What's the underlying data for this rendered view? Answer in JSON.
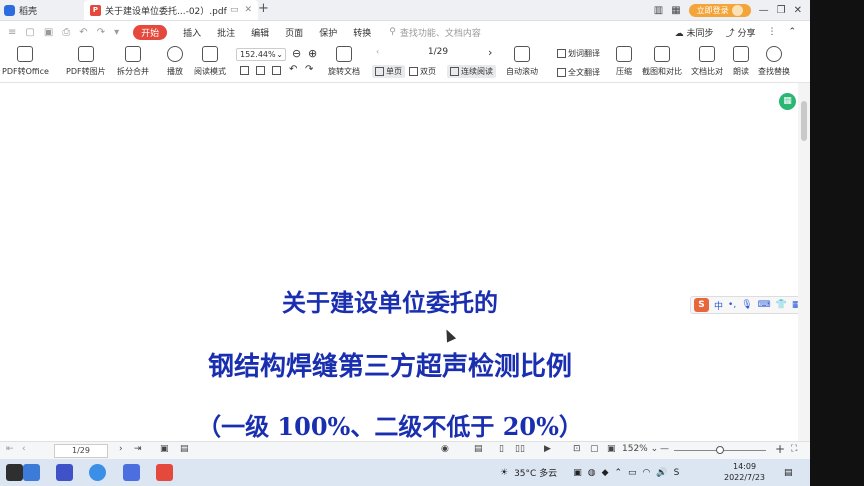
{
  "titlebar": {
    "home_tab": "稻壳",
    "doc_tab": "关于建设单位委托...-02）.pdf",
    "new_tab": "+",
    "login": "立即登录"
  },
  "menu": {
    "active": "开始",
    "items": [
      "插入",
      "批注",
      "编辑",
      "页面",
      "保护",
      "转换"
    ],
    "search_placeholder": "查找功能、文档内容",
    "right": [
      "未同步",
      "分享"
    ]
  },
  "toolbar": {
    "pdf_to_office": "PDF转Office",
    "pdf_to_image": "PDF转图片",
    "split_merge": "拆分合并",
    "play": "播放",
    "read_mode": "阅读模式",
    "zoom": "152.44%",
    "rotate": "旋转文档",
    "page_indicator": "1/29",
    "single": "单页",
    "double": "双页",
    "continuous": "连续阅读",
    "auto_scroll": "自动滚动",
    "word_translate": "划词翻译",
    "full_translate": "全文翻译",
    "compress": "压缩",
    "screenshot_compare": "截图和对比",
    "doc_compare": "文档比对",
    "read_aloud": "朗读",
    "find_replace": "查找替换"
  },
  "document": {
    "line1": "关于建设单位委托的",
    "line2": "钢结构焊缝第三方超声检测比例",
    "line3": "（一级 100%、二级不低于 20%）"
  },
  "ime": {
    "lang": "中"
  },
  "statusbar": {
    "page": "1/29",
    "zoom": "152%"
  },
  "taskbar": {
    "weather": "35°C 多云",
    "time": "14:09",
    "date": "2022/7/23"
  },
  "colors": {
    "accent": "#e5483c",
    "doc_text": "#1a2fb0",
    "login": "#f3a53a"
  }
}
